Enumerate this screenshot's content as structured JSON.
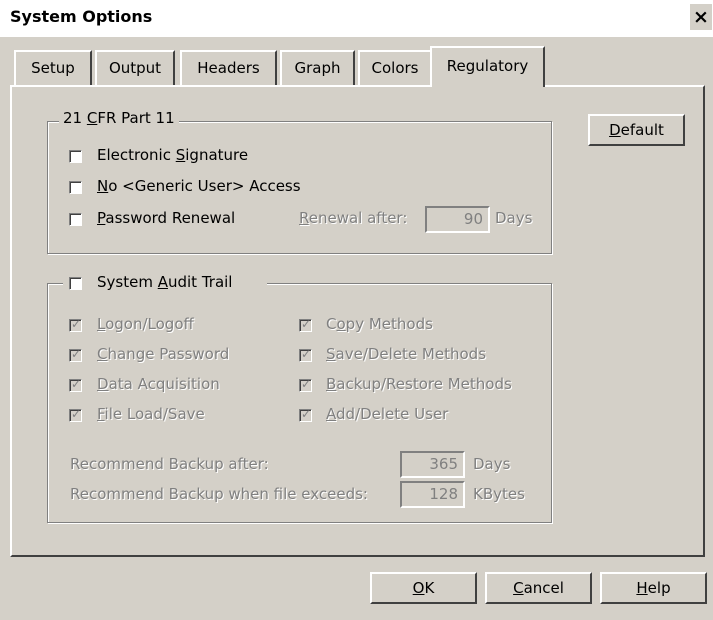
{
  "window": {
    "title": "System Options",
    "close_glyph": "×"
  },
  "tabs": [
    {
      "label": "Setup"
    },
    {
      "label": "Output"
    },
    {
      "label": "Headers"
    },
    {
      "label": "Graph"
    },
    {
      "label": "Colors"
    },
    {
      "label": "Regulatory",
      "active": true
    }
  ],
  "cfr": {
    "title_pre": "21 ",
    "title_u": "C",
    "title_post": "FR Part 11",
    "electronic_signature": {
      "pre": "Electronic ",
      "u": "S",
      "post": "ignature",
      "checked": false
    },
    "no_generic_user": {
      "pre": "",
      "u": "N",
      "post": "o <Generic User> Access",
      "checked": false
    },
    "password_renewal": {
      "pre": "",
      "u": "P",
      "post": "assword Renewal",
      "checked": false
    },
    "renewal_after": {
      "pre": "",
      "u": "R",
      "post": "enewal after:",
      "value": "90",
      "unit": "Days"
    }
  },
  "default_button": {
    "pre": "",
    "u": "D",
    "post": "efault"
  },
  "audit": {
    "title_pre": "System ",
    "title_u": "A",
    "title_post": "udit Trail",
    "checked": false,
    "left_items": [
      {
        "pre": "",
        "u": "L",
        "post": "ogon/Logoff",
        "checked": true
      },
      {
        "pre": "",
        "u": "C",
        "post": "hange Password",
        "checked": true
      },
      {
        "pre": "",
        "u": "D",
        "post": "ata Acquisition",
        "checked": true
      },
      {
        "pre": "",
        "u": "F",
        "post": "ile Load/Save",
        "checked": true
      }
    ],
    "right_items": [
      {
        "pre": "C",
        "u": "o",
        "post": "py Methods",
        "checked": true
      },
      {
        "pre": "",
        "u": "S",
        "post": "ave/Delete Methods",
        "checked": true
      },
      {
        "pre": "",
        "u": "B",
        "post": "ackup/Restore Methods",
        "checked": true
      },
      {
        "pre": "",
        "u": "A",
        "post": "dd/Delete User",
        "checked": true
      }
    ],
    "backup_after": {
      "label": "Recommend Backup after:",
      "value": "365",
      "unit": "Days"
    },
    "backup_size": {
      "label": "Recommend Backup when file exceeds:",
      "value": "128",
      "unit": "KBytes"
    }
  },
  "buttons": {
    "ok": {
      "pre": "",
      "u": "O",
      "post": "K"
    },
    "cancel": {
      "pre": "",
      "u": "C",
      "post": "ancel"
    },
    "help": {
      "pre": "",
      "u": "H",
      "post": "elp"
    }
  },
  "check_glyph": "✓"
}
